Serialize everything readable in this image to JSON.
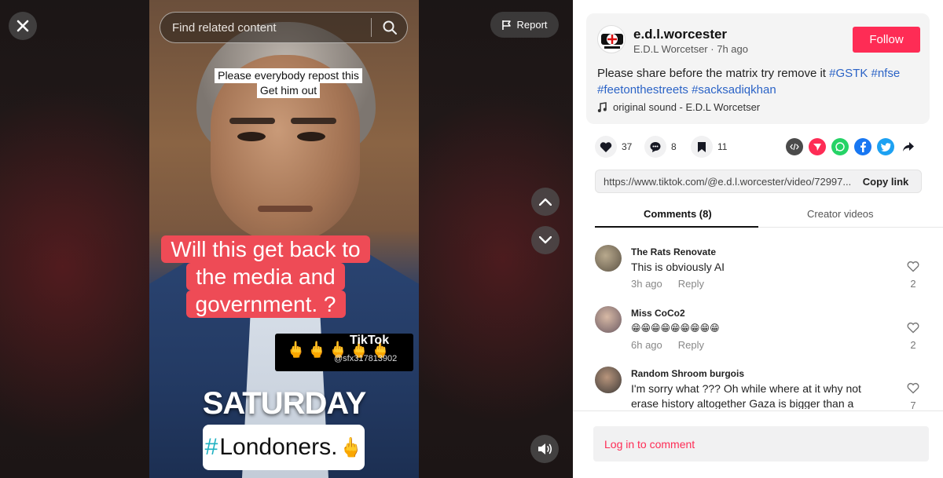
{
  "video": {
    "search_placeholder": "Find related content",
    "report_label": "Report",
    "caption_top_line1": "Please everybody repost this",
    "caption_top_line2": "Get him out",
    "red_caption_line1": "Will this get back to",
    "red_caption_line2": "the media and",
    "red_caption_line3": "government. ?",
    "emoji_overlay": "🖕🖕🖕🖕🖕",
    "watermark": "TikTok",
    "watermark_handle": "@sfx317813902",
    "saturday": "SATURDAY",
    "hashtag_sign": "#",
    "hashtag_word": "Londoners.",
    "hashtag_emoji": "🖕"
  },
  "author": {
    "username": "e.d.l.worcester",
    "display_name": "E.D.L Worcetser",
    "time_ago": "7h ago",
    "follow_label": "Follow",
    "desc_text": "Please share before the matrix try remove it",
    "tags": [
      "#GSTK",
      "#nfse",
      "#feetonthestreets",
      "#sacksadiqkhan"
    ],
    "sound": "original sound - E.D.L Worcetser"
  },
  "actions": {
    "likes": "37",
    "comments": "8",
    "saves": "11"
  },
  "link": {
    "url": "https://www.tiktok.com/@e.d.l.worcester/video/72997...",
    "copy_label": "Copy link"
  },
  "tabs": {
    "comments": "Comments (8)",
    "creator": "Creator videos"
  },
  "comments": [
    {
      "name": "The Rats Renovate",
      "text": "This is obviously AI",
      "time": "3h ago",
      "reply": "Reply",
      "likes": "2"
    },
    {
      "name": "Miss CoCo2",
      "text": "😁😁😁😁😁😁😁😁😁",
      "time": "6h ago",
      "reply": "Reply",
      "likes": "2"
    },
    {
      "name": "Random Shroom burgois",
      "text": "I'm sorry what ??? Oh while where at it why not erase history altogether Gaza is bigger than a",
      "time": "",
      "reply": "",
      "likes": "7"
    }
  ],
  "login_label": "Log in to comment",
  "colors": {
    "brand_red": "#fe2c55",
    "tag_blue": "#2b63c6",
    "caption_red": "#ee4b56"
  }
}
